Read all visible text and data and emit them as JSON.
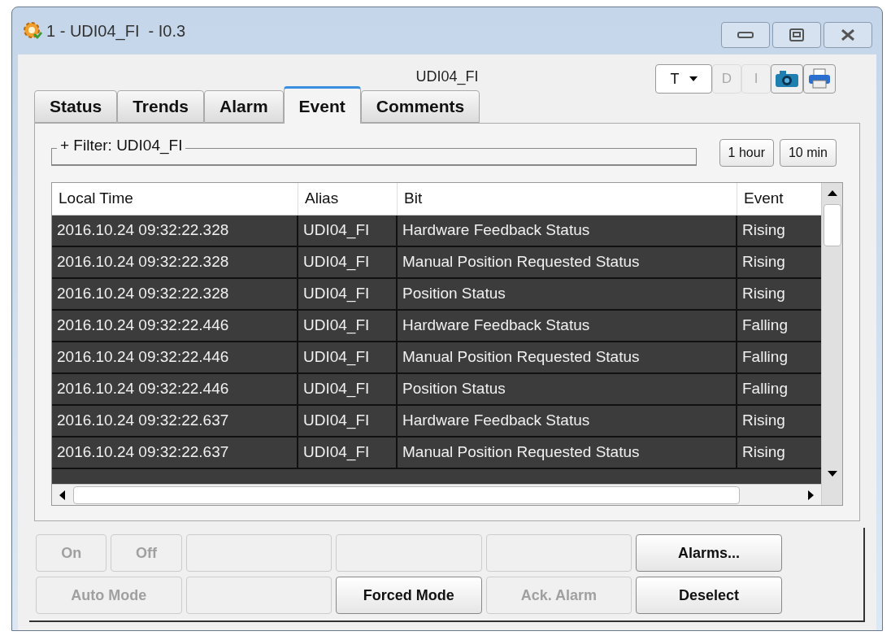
{
  "window": {
    "title": "1 - UDI04_FI  - I0.3"
  },
  "subtitle": "UDI04_FI",
  "toolbar": [
    {
      "kind": "dropdown",
      "label": "T",
      "disabled": false
    },
    {
      "kind": "text",
      "label": "D",
      "disabled": true
    },
    {
      "kind": "text",
      "label": "I",
      "disabled": true
    },
    {
      "kind": "camera"
    },
    {
      "kind": "printer"
    }
  ],
  "tabs": [
    {
      "label": "Status",
      "selected": false
    },
    {
      "label": "Trends",
      "selected": false
    },
    {
      "label": "Alarm",
      "selected": false
    },
    {
      "label": "Event",
      "selected": true
    },
    {
      "label": "Comments",
      "selected": false
    }
  ],
  "filter": {
    "label": "+ Filter: UDI04_FI"
  },
  "time_buttons": [
    "1 hour",
    "10 min"
  ],
  "table": {
    "columns": [
      "Local Time",
      "Alias",
      "Bit",
      "Event"
    ],
    "rows": [
      {
        "cells": [
          "2016.10.24 09:32:22.328",
          "UDI04_FI",
          "Hardware Feedback Status",
          "Rising"
        ],
        "selected": true
      },
      {
        "cells": [
          "2016.10.24 09:32:22.328",
          "UDI04_FI",
          "Manual Position Requested Status",
          "Rising"
        ],
        "selected": true
      },
      {
        "cells": [
          "2016.10.24 09:32:22.328",
          "UDI04_FI",
          "Position Status",
          "Rising"
        ],
        "selected": true
      },
      {
        "cells": [
          "2016.10.24 09:32:22.446",
          "UDI04_FI",
          "Hardware Feedback Status",
          "Falling"
        ],
        "selected": true
      },
      {
        "cells": [
          "2016.10.24 09:32:22.446",
          "UDI04_FI",
          "Manual Position Requested Status",
          "Falling"
        ],
        "selected": true
      },
      {
        "cells": [
          "2016.10.24 09:32:22.446",
          "UDI04_FI",
          "Position Status",
          "Falling"
        ],
        "selected": true
      },
      {
        "cells": [
          "2016.10.24 09:32:22.637",
          "UDI04_FI",
          "Hardware Feedback Status",
          "Rising"
        ],
        "selected": true
      },
      {
        "cells": [
          "2016.10.24 09:32:22.637",
          "UDI04_FI",
          "Manual Position Requested Status",
          "Rising"
        ],
        "selected": true
      }
    ]
  },
  "command_buttons": [
    [
      {
        "kind": "button",
        "label": "On",
        "disabled": true
      },
      {
        "kind": "button",
        "label": "Off",
        "disabled": true
      },
      {
        "kind": "blank"
      },
      {
        "kind": "blank"
      },
      {
        "kind": "blank"
      },
      {
        "kind": "button",
        "label": "Alarms...",
        "disabled": false
      }
    ],
    [
      {
        "kind": "button",
        "label": "Auto Mode",
        "disabled": true
      },
      {
        "kind": "blank"
      },
      {
        "kind": "button",
        "label": "Forced Mode",
        "disabled": false
      },
      {
        "kind": "button",
        "label": "Ack. Alarm",
        "disabled": true
      },
      {
        "kind": "button",
        "label": "Deselect",
        "disabled": false
      }
    ]
  ]
}
